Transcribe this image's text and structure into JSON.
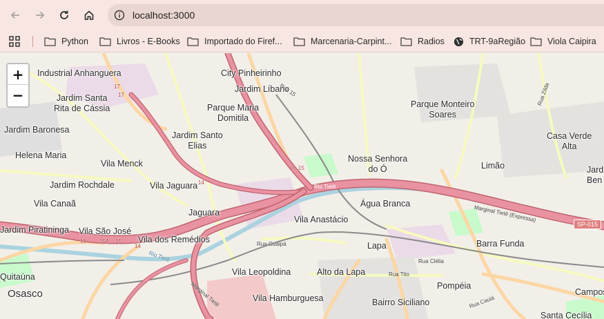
{
  "browser": {
    "url": "localhost:3000",
    "icons": {
      "back": "arrow-left-icon",
      "forward": "arrow-right-icon",
      "reload": "reload-icon",
      "home": "home-icon",
      "site_info": "info-circle-icon"
    }
  },
  "bookmarks": [
    {
      "label": "Python",
      "icon": "folder-icon"
    },
    {
      "label": "Livros - E-Books",
      "icon": "folder-icon"
    },
    {
      "label": "Importado do Firef...",
      "icon": "folder-icon"
    },
    {
      "label": "Marcenaria-Carpint...",
      "icon": "folder-icon"
    },
    {
      "label": "Radios",
      "icon": "folder-icon"
    },
    {
      "label": "TRT-9aRegião",
      "icon": "globe-icon"
    },
    {
      "label": "Viola Caipira",
      "icon": "folder-icon"
    }
  ],
  "map": {
    "zoom_in_label": "+",
    "zoom_out_label": "−",
    "places": [
      "Industrial Anhanguera",
      "City Pinheirinho",
      "Jardim Líbano",
      "Jardim Santa\nRita de Cássia",
      "Parque Maria\nDomitila",
      "Parque Monteiro\nSoares",
      "Jardim Baronesa",
      "Jardim Santo\nElias",
      "Casa Verde\nAlta",
      "Helena Maria",
      "Vila Menck",
      "Nossa Senhora\ndo Ó",
      "Limão",
      "Jardim\nBen",
      "Jardim Rochdale",
      "Vila Jaguara",
      "Vila Canaã",
      "Jaguara",
      "Água Branca",
      "Jardim Piratininga",
      "Vila São José",
      "Vila Anastácio",
      "Vila dos Remédios",
      "Lapa",
      "Barra Funda",
      "Quitaúna",
      "Vila Leopoldina",
      "Alto da Lapa",
      "Osasco",
      "Pompéia",
      "Vila Hamburguesa",
      "Bairro Siciliano",
      "Campos",
      "Santa Cecília"
    ],
    "road_labels": [
      "17",
      "17",
      "Rua 15",
      "km 15",
      "Rio Tietê",
      "14",
      "Marginal Tietê (Expressa)",
      "16",
      "15A",
      "15",
      "14",
      "Rio Tietê",
      "Rua Guaipá",
      "Rua Clélia",
      "Rua Tito",
      "Marginal Tietê",
      "Rua Zilda",
      "Rua Cauiá"
    ],
    "shield": "SP-015",
    "colors": {
      "motorway": "#e892a2",
      "primary": "#fcd6a4",
      "secondary": "#f7fabf",
      "water": "#aad3df",
      "park": "#c8facc",
      "industrial": "#ebdbe8",
      "rail": "#8a8a8a"
    }
  }
}
